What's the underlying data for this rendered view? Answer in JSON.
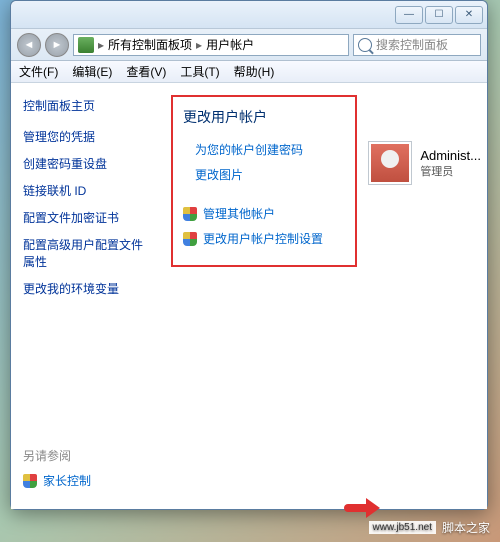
{
  "titlebar": {
    "min": "—",
    "max": "☐",
    "close": "✕"
  },
  "addr": {
    "root": "所有控制面板项",
    "current": "用户帐户",
    "searchPlaceholder": "搜索控制面板"
  },
  "menu": {
    "file": "文件(F)",
    "edit": "编辑(E)",
    "view": "查看(V)",
    "tools": "工具(T)",
    "help": "帮助(H)"
  },
  "sidebar": {
    "title": "控制面板主页",
    "items": [
      "管理您的凭据",
      "创建密码重设盘",
      "链接联机 ID",
      "配置文件加密证书",
      "配置高级用户配置文件属性",
      "更改我的环境变量"
    ]
  },
  "main": {
    "heading": "更改用户帐户",
    "actions": [
      "为您的帐户创建密码",
      "更改图片"
    ],
    "shieldActions": [
      "管理其他帐户",
      "更改用户帐户控制设置"
    ]
  },
  "user": {
    "name": "Administ...",
    "role": "管理员"
  },
  "footer": {
    "title": "另请参阅",
    "link": "家长控制"
  },
  "watermark": {
    "url": "www.jb51.net",
    "text": "脚本之家"
  }
}
